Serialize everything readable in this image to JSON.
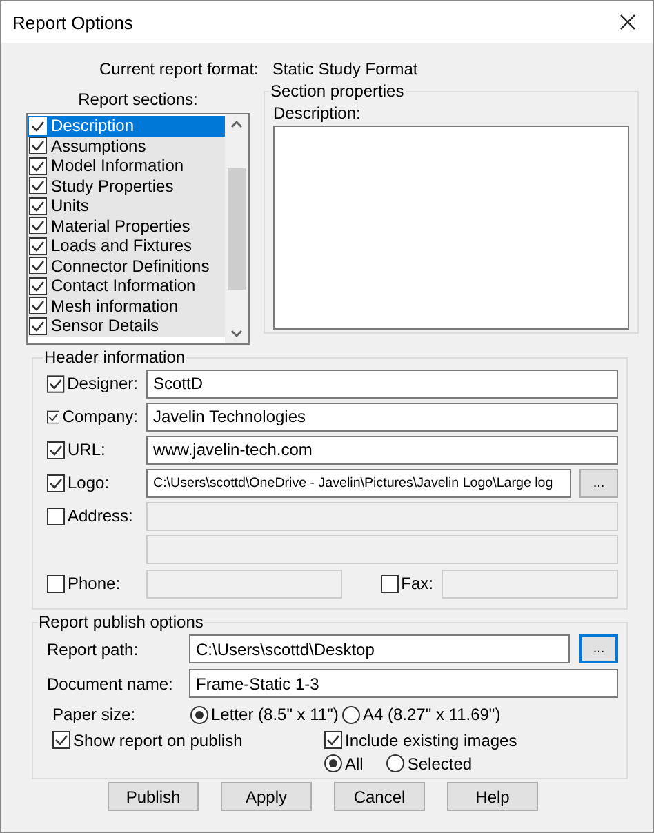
{
  "window": {
    "title": "Report Options"
  },
  "current_format": {
    "label": "Current report format:",
    "value": "Static Study Format"
  },
  "report_sections": {
    "label": "Report sections:",
    "items": [
      {
        "label": "Description",
        "checked": true,
        "selected": true
      },
      {
        "label": "Assumptions",
        "checked": true,
        "selected": false
      },
      {
        "label": "Model Information",
        "checked": true,
        "selected": false
      },
      {
        "label": "Study Properties",
        "checked": true,
        "selected": false
      },
      {
        "label": "Units",
        "checked": true,
        "selected": false
      },
      {
        "label": "Material Properties",
        "checked": true,
        "selected": false
      },
      {
        "label": "Loads and Fixtures",
        "checked": true,
        "selected": false
      },
      {
        "label": "Connector Definitions",
        "checked": true,
        "selected": false
      },
      {
        "label": "Contact Information",
        "checked": true,
        "selected": false
      },
      {
        "label": "Mesh information",
        "checked": true,
        "selected": false
      },
      {
        "label": "Sensor Details",
        "checked": true,
        "selected": false
      }
    ]
  },
  "section_properties": {
    "title": "Section properties",
    "description_label": "Description:"
  },
  "header_information": {
    "title": "Header information",
    "fields": [
      {
        "kind": "text",
        "label": "Designer:",
        "checked": true,
        "value": "ScottD"
      },
      {
        "kind": "text",
        "label": "Company:",
        "checked": true,
        "value": "Javelin Technologies"
      },
      {
        "kind": "text",
        "label": "URL:",
        "checked": true,
        "value": "www.javelin-tech.com"
      },
      {
        "kind": "browse",
        "label": "Logo:",
        "checked": true,
        "value": "C:\\Users\\scottd\\OneDrive - Javelin\\Pictures\\Javelin Logo\\Large log",
        "browse": "..."
      },
      {
        "kind": "multiline",
        "label": "Address:",
        "checked": false
      }
    ],
    "contact": [
      {
        "label": "Phone:",
        "checked": false
      },
      {
        "label": "Fax:",
        "checked": false
      }
    ]
  },
  "publish_options": {
    "title": "Report publish options",
    "report_path": {
      "label": "Report path:",
      "value": "C:\\Users\\scottd\\Desktop",
      "browse": "...",
      "browse_focused": true
    },
    "document_name": {
      "label": "Document name:",
      "value": "Frame-Static 1-3"
    },
    "paper_size": {
      "label": "Paper size:",
      "options": [
        {
          "label": "Letter (8.5\" x 11\")",
          "selected": true
        },
        {
          "label": "A4 (8.27\" x 11.69\")",
          "selected": false
        }
      ]
    },
    "show_on_publish": {
      "label": "Show report on publish",
      "checked": true
    },
    "include_images": {
      "label": "Include existing images",
      "checked": true
    },
    "image_scope": [
      {
        "label": "All",
        "selected": true
      },
      {
        "label": "Selected",
        "selected": false
      }
    ]
  },
  "buttons": [
    "Publish",
    "Apply",
    "Cancel",
    "Help"
  ]
}
